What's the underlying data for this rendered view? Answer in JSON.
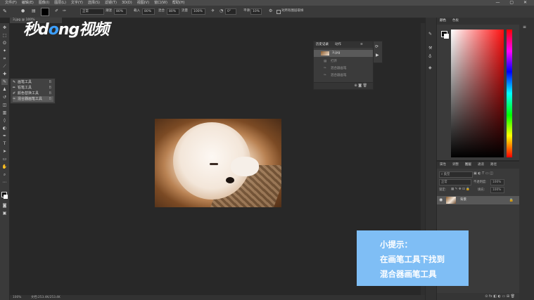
{
  "menu": {
    "items": [
      "文件(F)",
      "编辑(E)",
      "图像(I)",
      "图层(L)",
      "文字(Y)",
      "选择(S)",
      "滤镜(T)",
      "3D(D)",
      "视图(V)",
      "窗口(W)",
      "帮助(H)"
    ],
    "window_controls": "— ▢ ✕"
  },
  "options": {
    "mode_label": "模式",
    "mode_value": "正常",
    "wet_label": "潮湿",
    "wet_value": "80%",
    "load_label": "载入",
    "load_value": "80%",
    "mix_label": "混合",
    "mix_value": "80%",
    "flow_label": "流量",
    "flow_value": "100%",
    "angle_value": "0°",
    "smooth_label": "平滑",
    "smooth_value": "10%",
    "sample_all_label": "对所有图层取样"
  },
  "document": {
    "tab_label": "3.jpg @ 100%"
  },
  "flyout": {
    "items": [
      {
        "label": "画笔工具",
        "key": "B"
      },
      {
        "label": "铅笔工具",
        "key": "B"
      },
      {
        "label": "颜色替换工具",
        "key": "B"
      },
      {
        "label": "混合器画笔工具",
        "key": "B"
      }
    ]
  },
  "history": {
    "tab_history": "历史记录",
    "tab_actions": "动作",
    "rows": [
      "3.jpg",
      "打开",
      "混合器画笔",
      "混合器画笔"
    ],
    "footer_icons": "⊕ ◙ 🗑"
  },
  "color_panel": {
    "tab_color": "颜色",
    "tab_swatches": "色板"
  },
  "layers": {
    "tabs": [
      "属性",
      "调整",
      "图层",
      "通道",
      "路径"
    ],
    "filter_label": "类型",
    "blend_mode": "正常",
    "opacity_label": "不透明度:",
    "opacity_value": "100%",
    "lock_label": "锁定:",
    "fill_label": "填充:",
    "fill_value": "100%",
    "layer_name": "背景",
    "footer_icons": "⊙ fx ◧ ◐ ▭ ⊞ 🗑"
  },
  "status": {
    "zoom": "100%",
    "doc_info": "文档:253.4K/253.4K"
  },
  "tip": {
    "title": "小提示：",
    "line1": "在画笔工具下找到",
    "line2": "混合器画笔工具"
  },
  "watermark": {
    "text_a": "秒d",
    "text_dot": "o",
    "text_b": "ng视频"
  },
  "colors": {
    "tip_bg": "#7fbef5",
    "workspace": "#282828",
    "panel": "#3a3a3a"
  }
}
